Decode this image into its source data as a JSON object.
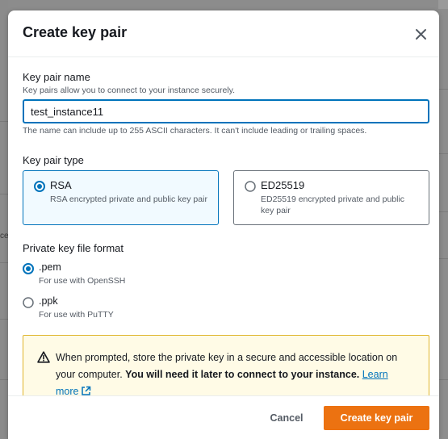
{
  "dialog": {
    "title": "Create key pair",
    "close_icon": "close-icon"
  },
  "backdrop": {
    "left_fragment_text": "ce"
  },
  "key_pair_name": {
    "label": "Key pair name",
    "description": "Key pairs allow you to connect to your instance securely.",
    "value": "test_instance11",
    "constraint": "The name can include up to 255 ASCII characters. It can't include leading or trailing spaces."
  },
  "key_pair_type": {
    "label": "Key pair type",
    "selected": "RSA",
    "options": [
      {
        "label": "RSA",
        "description": "RSA encrypted private and public key pair"
      },
      {
        "label": "ED25519",
        "description": "ED25519 encrypted private and public key pair"
      }
    ]
  },
  "file_format": {
    "label": "Private key file format",
    "selected": ".pem",
    "options": [
      {
        "label": ".pem",
        "description": "For use with OpenSSH"
      },
      {
        "label": ".ppk",
        "description": "For use with PuTTY"
      }
    ]
  },
  "alert": {
    "icon": "warning-icon",
    "text_part1": "When prompted, store the private key in a secure and accessible location on your computer. ",
    "text_bold": "You will need it later to connect to your instance.",
    "link_word1": "Learn",
    "link_word2": "more",
    "link_icon": "external-link-icon"
  },
  "footer": {
    "cancel_label": "Cancel",
    "create_label": "Create key pair"
  },
  "colors": {
    "primary_button": "#ec7211",
    "selected_accent": "#0073bb",
    "selected_tile_bg": "#f1faff",
    "warning_bg": "#fffbe6",
    "warning_border": "#dfb52c"
  }
}
